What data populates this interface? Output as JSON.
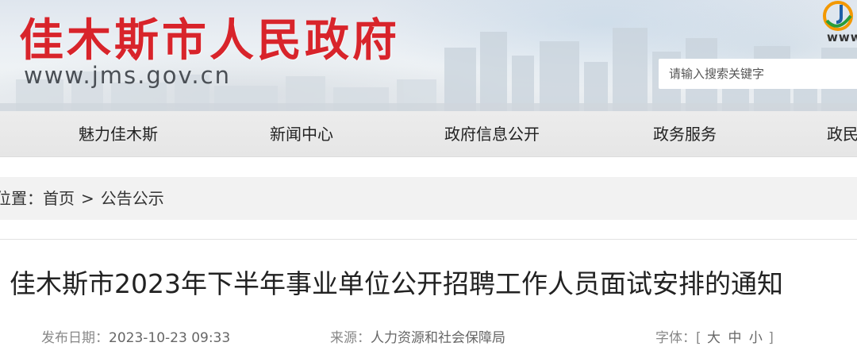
{
  "header": {
    "site_name": "佳木斯市人民政府",
    "site_url": "www.jms.gov.cn",
    "corner_logo_text": "www",
    "search": {
      "placeholder": "请输入搜索关键字"
    }
  },
  "nav": {
    "items": [
      {
        "label": "魅力佳木斯"
      },
      {
        "label": "新闻中心"
      },
      {
        "label": "政府信息公开"
      },
      {
        "label": "政务服务"
      },
      {
        "label": "政民"
      }
    ]
  },
  "breadcrumb": {
    "prefix": "位置：",
    "home": "首页",
    "separator": ">",
    "current": "公告公示"
  },
  "article": {
    "title": "佳木斯市2023年下半年事业单位公开招聘工作人员面试安排的通知",
    "publish_label": "发布日期：",
    "publish_date": "2023-10-23 09:33",
    "source_label": "来源：",
    "source": "人力资源和社会保障局",
    "fontsize_label": "字体：",
    "fontsize_open": "[",
    "fontsize_large": "大",
    "fontsize_medium": "中",
    "fontsize_small": "小",
    "fontsize_close": "]"
  },
  "colors": {
    "brand_red": "#d8242b",
    "nav_bg": "#e8e8e8",
    "crumb_bg": "#f2f2f2"
  }
}
